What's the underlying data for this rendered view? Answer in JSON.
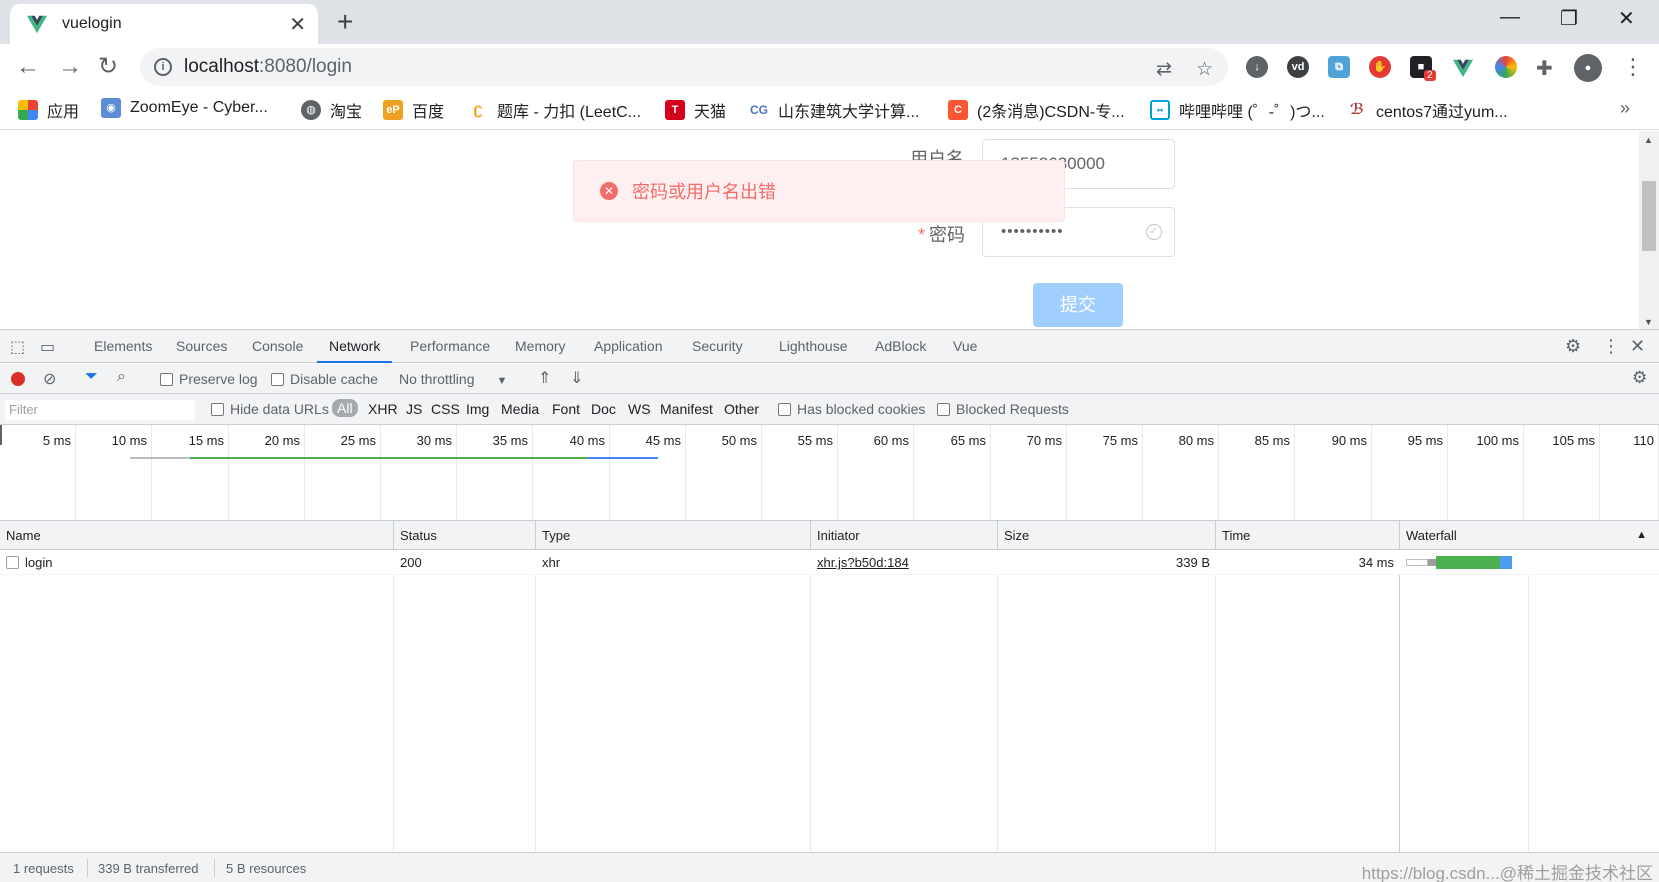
{
  "browser": {
    "tab_title": "vuelogin",
    "url_host": "localhost",
    "url_path": ":8080/login",
    "extension_badge": "2",
    "bookmarks": [
      {
        "label": "应用",
        "icon": "apps-grid-icon",
        "color": "#4285f4"
      },
      {
        "label": "ZoomEye - Cyber...",
        "icon": "zoomeye-icon",
        "color": "#5a8dd6"
      },
      {
        "label": "淘宝",
        "icon": "globe-icon",
        "color": "#5f6368"
      },
      {
        "label": "百度",
        "icon": "ep-icon",
        "color": "#f0a020"
      },
      {
        "label": "题库 - 力扣 (LeetC...",
        "icon": "leetcode-icon",
        "color": "#f89f1b"
      },
      {
        "label": "天猫",
        "icon": "tmall-icon",
        "color": "#d4001c"
      },
      {
        "label": "山东建筑大学计算...",
        "icon": "cg-icon",
        "color": "#4d6fc4"
      },
      {
        "label": "(2条消息)CSDN-专...",
        "icon": "csdn-icon",
        "color": "#fc5531"
      },
      {
        "label": "哔哩哔哩 (゜-゜)つ...",
        "icon": "bilibili-icon",
        "color": "#00a1d6"
      },
      {
        "label": "centos7通过yum...",
        "icon": "centos-icon",
        "color": "#b23b3b"
      }
    ]
  },
  "page": {
    "username_label": "用户名",
    "username_value": "13558630000",
    "password_label": "密码",
    "password_value": "••••••••••",
    "required_mark": "*",
    "submit_label": "提交",
    "error_message": "密码或用户名出错",
    "error_color": "#f56c6c"
  },
  "devtools": {
    "tabs": [
      "Elements",
      "Sources",
      "Console",
      "Network",
      "Performance",
      "Memory",
      "Application",
      "Security",
      "Lighthouse",
      "AdBlock",
      "Vue"
    ],
    "active_tab": "Network",
    "preserve_log": "Preserve log",
    "disable_cache": "Disable cache",
    "throttling": "No throttling",
    "filter_placeholder": "Filter",
    "hide_data_urls": "Hide data URLs",
    "type_filters": [
      "All",
      "XHR",
      "JS",
      "CSS",
      "Img",
      "Media",
      "Font",
      "Doc",
      "WS",
      "Manifest",
      "Other"
    ],
    "has_blocked_cookies": "Has blocked cookies",
    "blocked_requests": "Blocked Requests",
    "ticks": [
      "5 ms",
      "10 ms",
      "15 ms",
      "20 ms",
      "25 ms",
      "30 ms",
      "35 ms",
      "40 ms",
      "45 ms",
      "50 ms",
      "55 ms",
      "60 ms",
      "65 ms",
      "70 ms",
      "75 ms",
      "80 ms",
      "85 ms",
      "90 ms",
      "95 ms",
      "100 ms",
      "105 ms",
      "110"
    ],
    "columns": [
      "Name",
      "Status",
      "Type",
      "Initiator",
      "Size",
      "Time",
      "Waterfall"
    ],
    "sort_indicator": "▲",
    "rows": [
      {
        "name": "login",
        "status": "200",
        "type": "xhr",
        "initiator": "xhr.js?b50d:184",
        "size": "339 B",
        "time": "34 ms"
      }
    ],
    "status_requests": "1 requests",
    "status_transferred": "339 B transferred",
    "status_resources": "5 B resources",
    "watermark": "https://blog.csdn...@稀土掘金技术社区"
  }
}
